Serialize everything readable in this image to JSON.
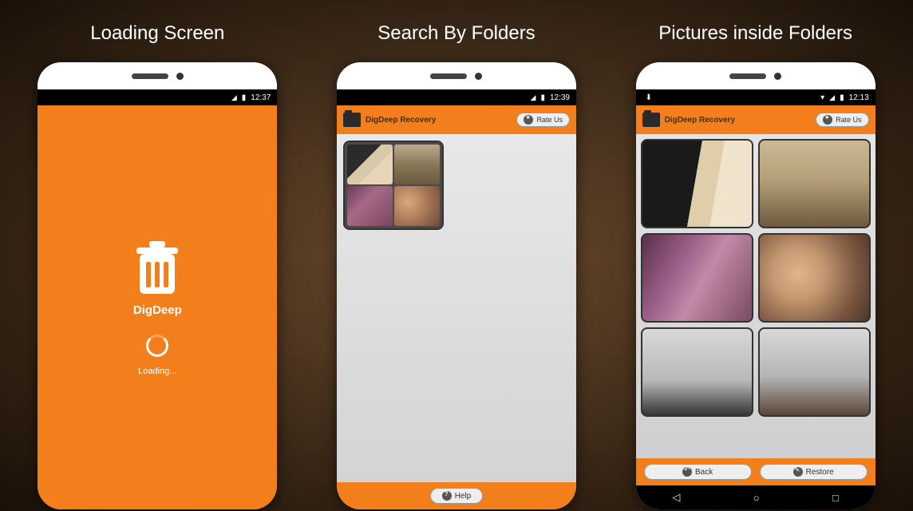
{
  "panels": [
    {
      "title": "Loading Screen"
    },
    {
      "title": "Search By Folders"
    },
    {
      "title": "Pictures inside Folders"
    }
  ],
  "status": {
    "time1": "12:37",
    "time2": "12:39",
    "time3": "12:13"
  },
  "loading": {
    "app_name": "DigDeep",
    "loading_text": "Loading..."
  },
  "header": {
    "app_title": "DigDeep Recovery",
    "rate_label": "Rate Us"
  },
  "footer": {
    "help_label": "Help",
    "back_label": "Back",
    "restore_label": "Restore"
  },
  "colors": {
    "accent": "#f27f1b"
  }
}
